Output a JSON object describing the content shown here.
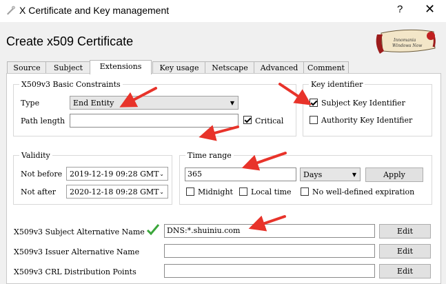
{
  "window": {
    "title": "X Certificate and Key management",
    "help": "?",
    "close": "✕"
  },
  "heading": "Create x509 Certificate",
  "tabs": [
    "Source",
    "Subject",
    "Extensions",
    "Key usage",
    "Netscape",
    "Advanced",
    "Comment"
  ],
  "active_tab": "Extensions",
  "basic_constraints": {
    "legend": "X509v3 Basic Constraints",
    "type_label": "Type",
    "type_value": "End Entity",
    "path_length_label": "Path length",
    "path_length_value": "",
    "critical_label": "Critical",
    "critical_checked": true
  },
  "key_identifier": {
    "legend": "Key identifier",
    "subject_label": "Subject Key Identifier",
    "subject_checked": true,
    "authority_label": "Authority Key Identifier",
    "authority_checked": false
  },
  "validity": {
    "legend": "Validity",
    "not_before_label": "Not before",
    "not_before_value": "2019-12-19 09:28 GMT",
    "not_after_label": "Not after",
    "not_after_value": "2020-12-18 09:28 GMT"
  },
  "time_range": {
    "legend": "Time range",
    "value": "365",
    "unit": "Days",
    "apply_label": "Apply",
    "midnight_label": "Midnight",
    "local_time_label": "Local time",
    "no_expiration_label": "No well-defined expiration"
  },
  "extensions": [
    {
      "label": "X509v3 Subject Alternative Name",
      "value": "DNS:*.shuiniu.com",
      "button": "Edit",
      "validated": true
    },
    {
      "label": "X509v3 Issuer Alternative Name",
      "value": "",
      "button": "Edit",
      "validated": false
    },
    {
      "label": "X509v3 CRL Distribution Points",
      "value": "",
      "button": "Edit",
      "validated": false
    }
  ],
  "colors": {
    "annotation_arrow": "#e8332a",
    "check_green": "#3aa63a",
    "logo_red": "#9c1c1c"
  },
  "logo_text": "Innomania Windows Now"
}
